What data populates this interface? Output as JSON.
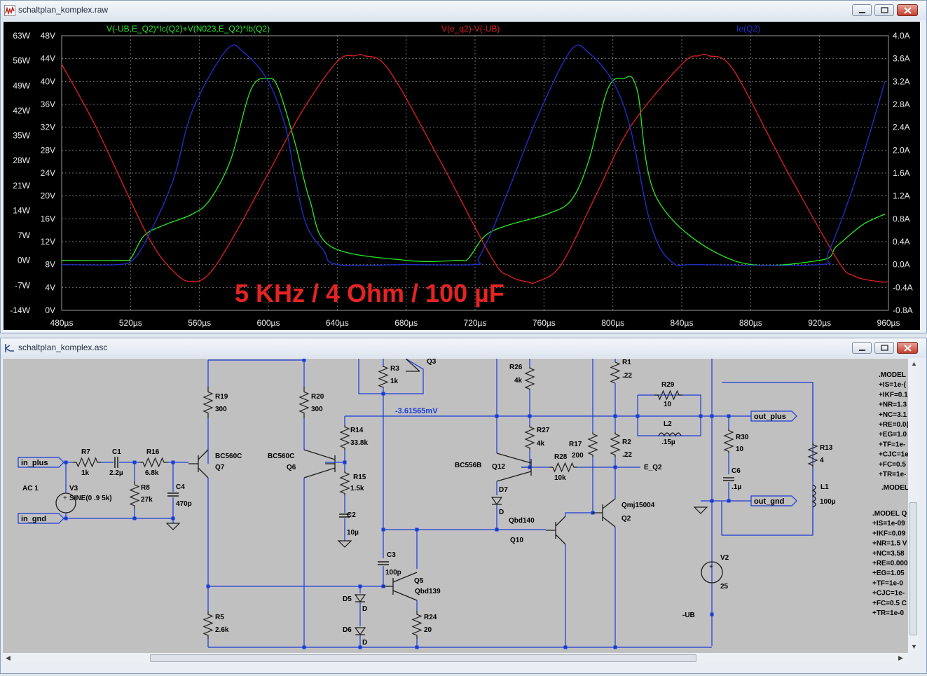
{
  "plot_window": {
    "title": "schaltplan_komplex.raw",
    "colors": {
      "bg": "#000000",
      "grid": "#6e6e6e",
      "axis_text": "#e8e8e8",
      "green": "#27e627",
      "red": "#e02020",
      "blue": "#2030d0"
    },
    "traces": [
      {
        "label": "V(-UB,E_Q2)*Ic(Q2)+V(N023,E_Q2)*Ib(Q2)",
        "color": "#27e627"
      },
      {
        "label": "V(e_q2)-V(-UB)",
        "color": "#e02020"
      },
      {
        "label": "Ie(Q2)",
        "color": "#2030d0"
      }
    ],
    "y_left_outer": [
      "63W",
      "56W",
      "49W",
      "42W",
      "35W",
      "28W",
      "21W",
      "14W",
      "7W",
      "0W",
      "-7W",
      "-14W"
    ],
    "y_left_inner": [
      "48V",
      "44V",
      "40V",
      "36V",
      "32V",
      "28V",
      "24V",
      "20V",
      "16V",
      "12V",
      "8V",
      "4V",
      "0V"
    ],
    "y_right": [
      "4.0A",
      "3.6A",
      "3.2A",
      "2.8A",
      "2.4A",
      "2.0A",
      "1.6A",
      "1.2A",
      "0.8A",
      "0.4A",
      "0.0A",
      "-0.4A",
      "-0.8A"
    ],
    "x_ticks": [
      "480µs",
      "520µs",
      "560µs",
      "600µs",
      "640µs",
      "680µs",
      "720µs",
      "760µs",
      "800µs",
      "840µs",
      "880µs",
      "920µs",
      "960µs"
    ],
    "annotation": "5 KHz / 4 Ohm / 100 µF"
  },
  "chart_data": {
    "type": "line",
    "x_unit": "µs",
    "xlim": [
      480,
      960
    ],
    "series": [
      {
        "name": "V(-UB,E_Q2)*Ic(Q2)+V(N023,E_Q2)*Ib(Q2)",
        "axis": "W",
        "x": [
          480,
          515,
          520,
          528,
          540,
          556,
          566,
          578,
          590,
          600,
          606,
          616,
          624,
          636,
          680,
          710,
          716,
          726,
          740,
          762,
          776,
          786,
          797,
          806,
          814,
          826,
          870,
          920,
          930,
          945,
          958
        ],
        "y": [
          0,
          0,
          0.5,
          7,
          10,
          13,
          17,
          28,
          48,
          51,
          48,
          32,
          17,
          4,
          0,
          0,
          0.5,
          7,
          10,
          13,
          17,
          28,
          48,
          51,
          48,
          17,
          0,
          0,
          4,
          10,
          13
        ]
      },
      {
        "name": "V(e_q2)-V(-UB)",
        "axis": "V",
        "x": [
          480,
          500,
          530,
          546,
          556,
          566,
          580,
          600,
          620,
          640,
          650,
          656,
          670,
          700,
          730,
          740,
          750,
          756,
          770,
          790,
          810,
          840,
          850,
          856,
          870,
          900,
          930,
          940,
          955,
          960
        ],
        "y": [
          43,
          32,
          13,
          6.5,
          5,
          6.5,
          13,
          24,
          35,
          43.5,
          44.5,
          44.5,
          42,
          26,
          9,
          6,
          5,
          5,
          8,
          20,
          32,
          43,
          44.5,
          44.5,
          42,
          25,
          9,
          6,
          5,
          5
        ]
      },
      {
        "name": "Ie(Q2)",
        "axis": "A",
        "x": [
          480,
          512,
          522,
          532,
          545,
          556,
          576,
          586,
          600,
          610,
          615,
          622,
          632,
          640,
          680,
          720,
          722,
          730,
          742,
          758,
          776,
          786,
          800,
          810,
          822,
          834,
          850,
          920,
          925,
          940,
          958
        ],
        "y": [
          0,
          0,
          0.1,
          0.6,
          1.5,
          2.7,
          3.76,
          3.7,
          3.2,
          2.4,
          1.6,
          0.7,
          0.25,
          0,
          0,
          0,
          0.1,
          0.6,
          1.5,
          2.7,
          3.76,
          3.7,
          3.2,
          2.4,
          0.7,
          0.05,
          0,
          0,
          0.2,
          1.4,
          3.2
        ]
      }
    ],
    "y_axes": {
      "W": [
        -14,
        63
      ],
      "V": [
        0,
        48
      ],
      "A": [
        -0.8,
        4.0
      ]
    }
  },
  "schem_window": {
    "title": "schaltplan_komplex.asc",
    "colors": {
      "bg": "#c0c0c0",
      "wire": "#1a3bd6",
      "part": "#1b1b1b",
      "text": "#000000",
      "probe": "#1a3bd6"
    },
    "labels": {
      "r19": "R19",
      "r19v": "300",
      "r20": "R20",
      "r20v": "300",
      "r3": "R3",
      "r3v": "1k",
      "q3": "Q3",
      "r26": "R26",
      "r26v": "4k",
      "r1": "R1",
      "r1v": ".22",
      "r29": "R29",
      "r29v": "10",
      "l2": "L2",
      "l2v": ".15µ",
      "r30": "R30",
      "r30v": "10",
      "r13": "R13",
      "r13v": "4",
      "l1": "L1",
      "l1v": "100µ",
      "c6": "C6",
      "c6v": ".1µ",
      "r7": "R7",
      "r7v": "1k",
      "c1": "C1",
      "c1v": "2.2µ",
      "r16": "R16",
      "r16v": "6.8k",
      "r8": "R8",
      "r8v": "27k",
      "c4": "C4",
      "c4v": "470p",
      "v3": "V3",
      "v3v": "SINE(0 .9 5k)",
      "ac": "AC 1",
      "q7a": "BC560C",
      "q7": "Q7",
      "q6a": "BC560C",
      "q6": "Q6",
      "r14": "R14",
      "r14v": "33.8k",
      "r15": "R15",
      "r15v": "1.5k",
      "c2": "C2",
      "c2v": "10µ",
      "r27": "R27",
      "r27v": "4k",
      "r28": "R28",
      "r28v": "10k",
      "r17": "R17",
      "r17v": "200",
      "r2": "R2",
      "r2v": ".22",
      "q12a": "BC556B",
      "q12": "Q12",
      "d7": "D7",
      "d7v": "D",
      "q10a": "Qbd140",
      "q10": "Q10",
      "q2a": "Qmj15004",
      "q2": "Q2",
      "c3": "C3",
      "c3v": "100p",
      "q5": "Q5",
      "q5a": "Qbd139",
      "d5": "D5",
      "d5v": "D",
      "d6": "D6",
      "d6v": "D",
      "r24": "R24",
      "r24v": "20",
      "r5": "R5",
      "r5v": "2.6k",
      "v2": "V2",
      "v2v": "25",
      "probe": "-3.61565mV",
      "eq2": "E_Q2",
      "ub": "-UB",
      "in_plus": "in_plus",
      "in_gnd": "in_gnd",
      "out_plus": "out_plus",
      "out_gnd": "out_gnd"
    },
    "model_block_1": [
      ".MODEL",
      "+IS=1e-(",
      "+IKF=0.1",
      "+NR=1.3",
      "+NC=3.1",
      "+RE=0.0(",
      "+EG=1.0",
      "+TF=1e-",
      "+CJC=1e-",
      "+FC=0.5",
      "+TR=1e-",
      ".MODEL"
    ],
    "model_block_2": [
      ".MODEL Q",
      "+IS=1e-09",
      "+IKF=0.09",
      "+NR=1.5 V",
      "+NC=3.58",
      "+RE=0.000",
      "+EG=1.05",
      "+TF=1e-0",
      "+CJC=1e-",
      "+FC=0.5 C",
      "+TR=1e-0"
    ]
  }
}
